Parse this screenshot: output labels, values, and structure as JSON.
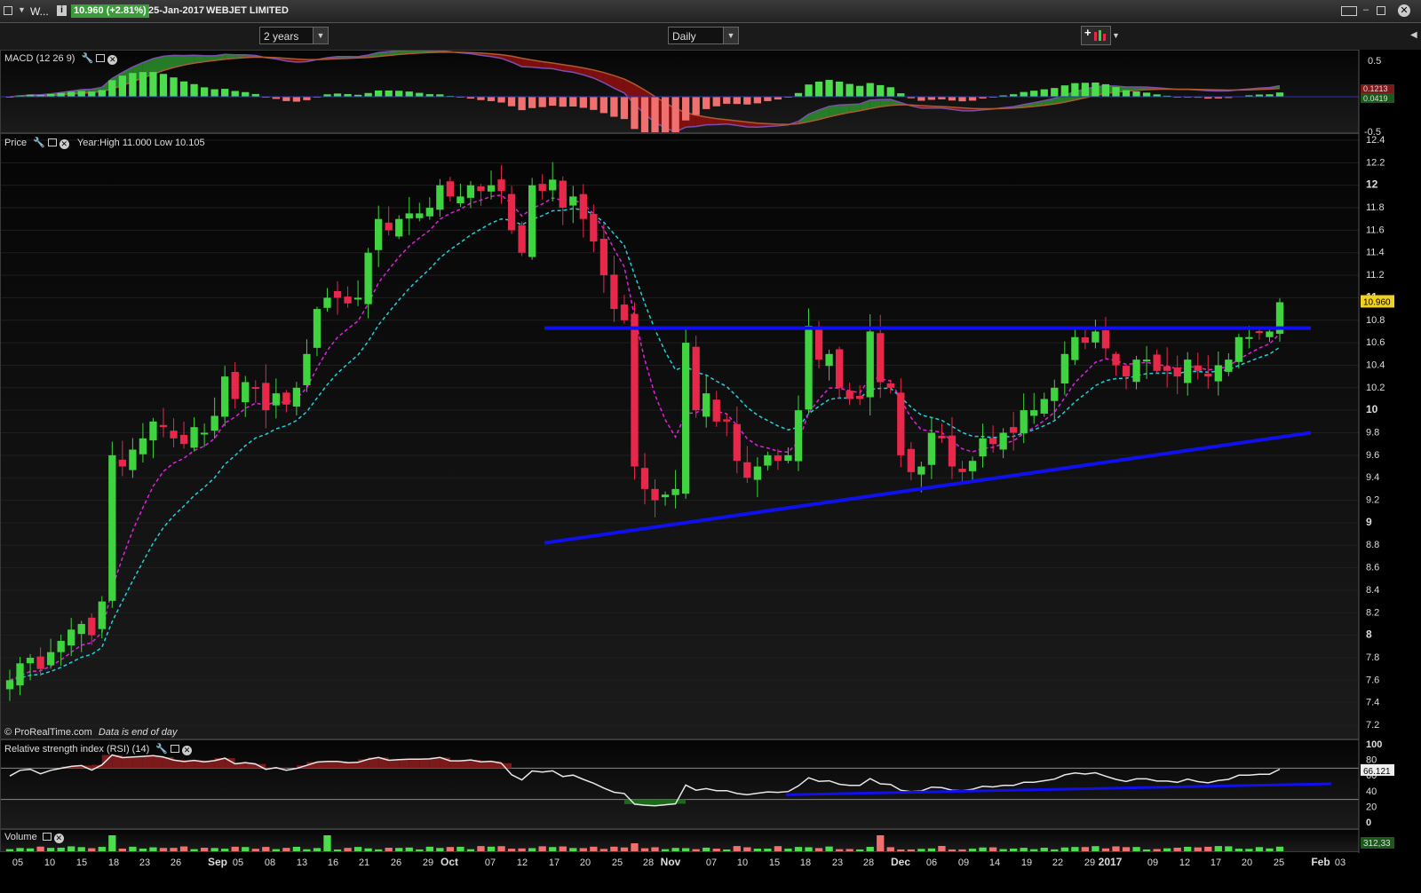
{
  "title_bar": {
    "short_name": "W...",
    "price_badge": "10.960 (+2.81%)",
    "date": "25-Jan-2017",
    "instrument": "WEBJET LIMITED"
  },
  "toolbar": {
    "period_select": "2 years",
    "interval_select": "Daily"
  },
  "panels": {
    "macd_label": "MACD (12 26 9)",
    "price_label": "Price",
    "price_info": "Year:High 11.000 Low 10.105",
    "rsi_label": "Relative strength index (RSI) (14)",
    "volume_label": "Volume",
    "watermark": "© ProRealTime.com",
    "watermark_note": "Data is end of day"
  },
  "colors": {
    "up": "#3fd43f",
    "down": "#e8284a",
    "ma_fast": "#e020e0",
    "ma_slow": "#20d0d8",
    "trendline": "#1010ee",
    "macd_pos_fill": "#2a8a2a",
    "macd_neg_fill": "#8a1010"
  },
  "chart_data": [
    {
      "type": "candlestick",
      "title": "",
      "y_ticks": [
        "12.4",
        "12.2",
        "12",
        "11.8",
        "11.6",
        "11.4",
        "11.2",
        "11",
        "10.8",
        "10.6",
        "10.4",
        "10.2",
        "10",
        "9.8",
        "9.6",
        "9.4",
        "9.2",
        "9",
        "8.8",
        "8.6",
        "8.4",
        "8.2",
        "8",
        "7.8",
        "7.6",
        "7.4",
        "7.2"
      ],
      "ylim": [
        7.1,
        12.45
      ],
      "last_price_label": "10.960",
      "x_tick_labels": [
        "05",
        "10",
        "15",
        "18",
        "23",
        "26",
        "Sep",
        "05",
        "08",
        "13",
        "16",
        "21",
        "26",
        "29",
        "Oct",
        "07",
        "12",
        "17",
        "20",
        "25",
        "28",
        "Nov",
        "07",
        "10",
        "15",
        "18",
        "23",
        "28",
        "Dec",
        "06",
        "09",
        "14",
        "19",
        "22",
        "29",
        "2017",
        "09",
        "12",
        "17",
        "20",
        "25",
        "Feb",
        "03"
      ],
      "closes": [
        7.6,
        7.75,
        7.8,
        7.7,
        7.85,
        7.95,
        8.05,
        8.1,
        8.0,
        8.3,
        9.6,
        9.5,
        9.65,
        9.75,
        9.9,
        9.85,
        9.75,
        9.7,
        9.85,
        9.8,
        9.95,
        10.3,
        10.1,
        10.25,
        10.2,
        10.0,
        10.15,
        10.05,
        10.2,
        10.5,
        10.9,
        11.0,
        11.0,
        10.95,
        11.0,
        11.4,
        11.7,
        11.6,
        11.7,
        11.75,
        11.75,
        11.8,
        12.0,
        11.9,
        11.9,
        12.0,
        11.95,
        12.0,
        11.95,
        11.6,
        11.4,
        12.0,
        11.95,
        12.05,
        11.8,
        11.9,
        11.7,
        11.5,
        11.2,
        10.9,
        10.8,
        9.5,
        9.3,
        9.2,
        9.25,
        9.3,
        10.6,
        10.0,
        10.15,
        9.9,
        9.9,
        9.55,
        9.4,
        9.5,
        9.6,
        9.55,
        9.6,
        10.0,
        10.75,
        10.45,
        10.5,
        10.2,
        10.1,
        10.1,
        10.7,
        10.25,
        10.2,
        9.6,
        9.45,
        9.5,
        9.8,
        9.75,
        9.5,
        9.45,
        9.55,
        9.75,
        9.7,
        9.8,
        9.8,
        10.0,
        10.0,
        10.1,
        10.2,
        10.5,
        10.65,
        10.6,
        10.7,
        10.55,
        10.4,
        10.3,
        10.45,
        10.45,
        10.35,
        10.35,
        10.3,
        10.45,
        10.35,
        10.3,
        10.4,
        10.45,
        10.65,
        10.65,
        10.7,
        10.7,
        10.96
      ]
    },
    {
      "type": "line",
      "title": "",
      "name": "Relative strength index (RSI) (14)",
      "y_ticks": [
        "100",
        "80",
        "60",
        "40",
        "20",
        "0"
      ],
      "ylim": [
        0,
        100
      ],
      "last_value_label": "66.121",
      "levels": [
        70,
        30
      ]
    },
    {
      "type": "bar",
      "title": "",
      "name": "MACD (12 26 9)",
      "y_ticks": [
        "0.5",
        "-0.5"
      ],
      "value_labels": [
        "0.1213",
        "0.0419"
      ]
    },
    {
      "type": "bar",
      "title": "",
      "name": "Volume",
      "last_value_label": "312,33"
    }
  ]
}
